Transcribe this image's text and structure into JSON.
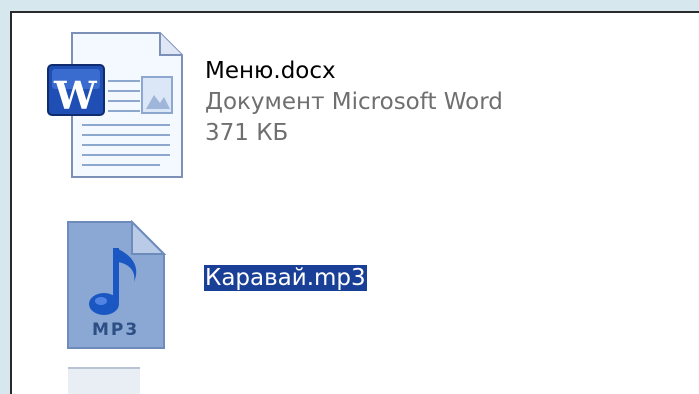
{
  "files": [
    {
      "name": "Меню.docx",
      "type": "Документ Microsoft Word",
      "size": "371 КБ",
      "icon": "word-document-icon",
      "icon_letter": "W"
    },
    {
      "name": "Каравай.mp3",
      "icon": "mp3-file-icon",
      "icon_label": "MP3",
      "selected": true
    }
  ],
  "colors": {
    "background_frame": "#d7e7ee",
    "selection": "#1a3f96",
    "word_blue": "#1f4fb5",
    "mp3_doc": "#8aa8d3"
  }
}
